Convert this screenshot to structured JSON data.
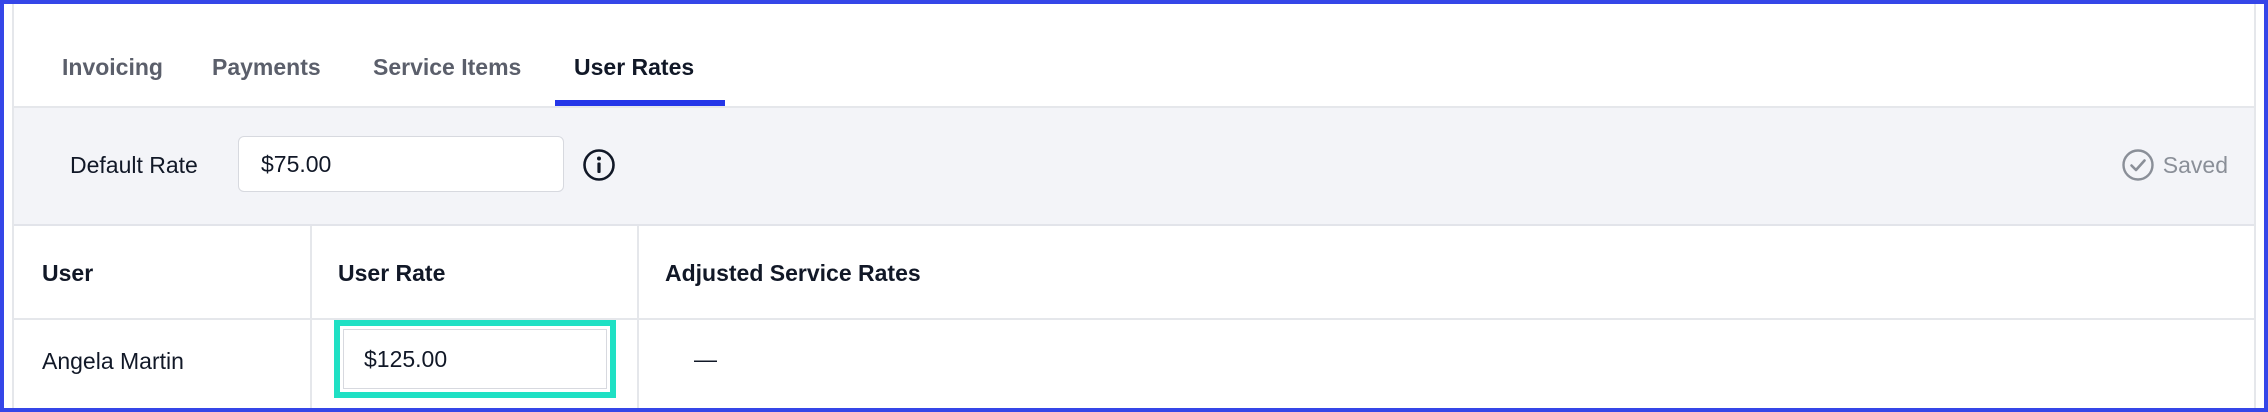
{
  "tabs": [
    {
      "label": "Invoicing",
      "active": false
    },
    {
      "label": "Payments",
      "active": false
    },
    {
      "label": "Service Items",
      "active": false
    },
    {
      "label": "User Rates",
      "active": true
    }
  ],
  "default_rate": {
    "label": "Default Rate",
    "value": "$75.00",
    "info_icon": "info-icon",
    "status_icon": "check-circle-icon",
    "status_text": "Saved"
  },
  "table": {
    "columns": [
      "User",
      "User Rate",
      "Adjusted Service Rates"
    ],
    "rows": [
      {
        "user": "Angela Martin",
        "rate": "$125.00",
        "adjusted": "—"
      }
    ]
  },
  "colors": {
    "accent": "#2436e8",
    "focus_ring": "#1fe0c4",
    "frame_border": "#3546e8",
    "bar_background": "#f3f4f8"
  }
}
